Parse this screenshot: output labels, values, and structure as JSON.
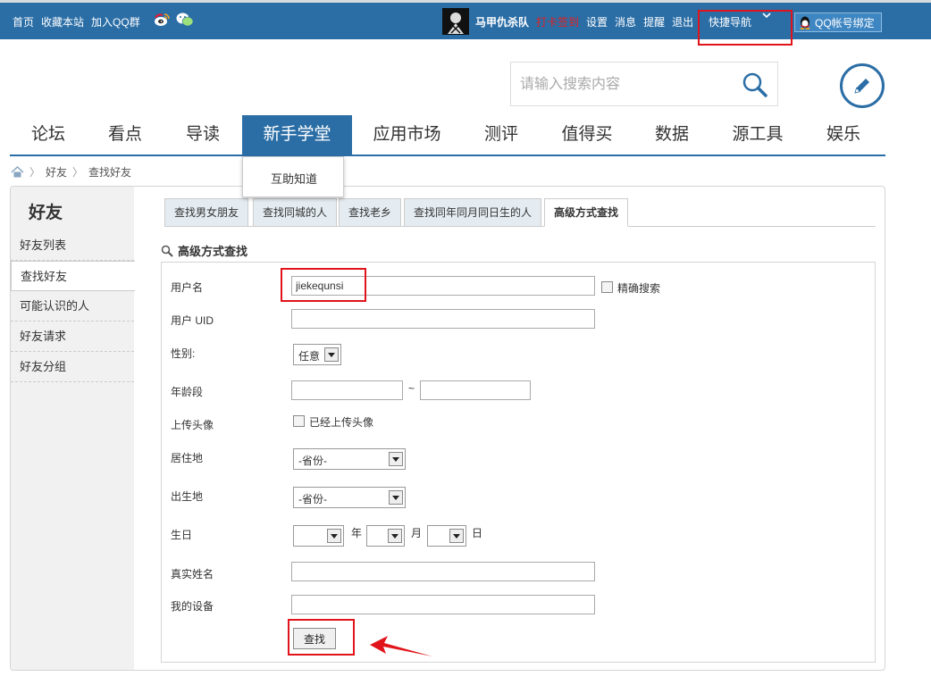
{
  "topbar": {
    "links": [
      "首页",
      "收藏本站",
      "加入QQ群"
    ],
    "username": "马甲仇杀队",
    "sign_in": "打卡签到",
    "actions": [
      "设置",
      "消息",
      "提醒",
      "退出"
    ],
    "quick_nav": "快捷导航",
    "qq_bind": "QQ帐号绑定"
  },
  "search": {
    "placeholder": "请输入搜索内容"
  },
  "nav": {
    "items": [
      "论坛",
      "看点",
      "导读",
      "新手学堂",
      "应用市场",
      "测评",
      "值得买",
      "数据",
      "源工具",
      "娱乐"
    ],
    "active_index": 3,
    "submenu": [
      "互助知道"
    ]
  },
  "breadcrumb": [
    "好友",
    "查找好友"
  ],
  "sidebar": {
    "title": "好友",
    "items": [
      "好友列表",
      "查找好友",
      "可能认识的人",
      "好友请求",
      "好友分组"
    ],
    "active_index": 1
  },
  "tabs": {
    "items": [
      "查找男女朋友",
      "查找同城的人",
      "查找老乡",
      "查找同年同月同日生的人",
      "高级方式查找"
    ],
    "active_index": 4
  },
  "form": {
    "section_title": "高级方式查找",
    "username_label": "用户名",
    "username_value": "jiekequnsi",
    "exact_search_label": "精确搜索",
    "uid_label": "用户 UID",
    "gender_label": "性别:",
    "gender_value": "任意",
    "age_label": "年龄段",
    "age_separator": "~",
    "avatar_label": "上传头像",
    "avatar_option": "已经上传头像",
    "residence_label": "居住地",
    "residence_value": "-省份-",
    "birthplace_label": "出生地",
    "birthplace_value": "-省份-",
    "birthday_label": "生日",
    "year_unit": "年",
    "month_unit": "月",
    "day_unit": "日",
    "realname_label": "真实姓名",
    "device_label": "我的设备",
    "submit_label": "查找"
  },
  "colors": {
    "brand_blue": "#2b6ea6",
    "highlight_red": "#e0141a"
  }
}
